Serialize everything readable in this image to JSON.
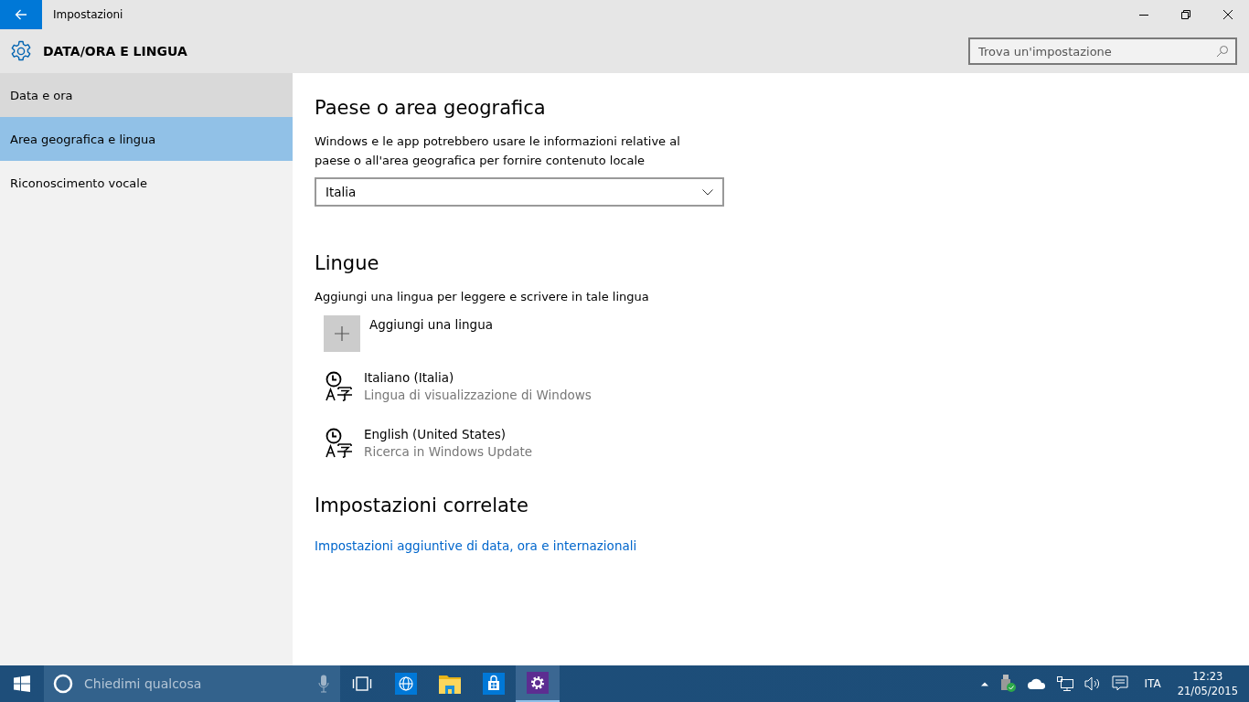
{
  "window": {
    "title": "Impostazioni"
  },
  "header": {
    "title": "DATA/ORA E LINGUA",
    "search": {
      "placeholder": "Trova un'impostazione"
    }
  },
  "sidebar": {
    "items": [
      {
        "label": "Data e ora",
        "selected": false,
        "hovered": true
      },
      {
        "label": "Area geografica e lingua",
        "selected": true,
        "hovered": false
      },
      {
        "label": "Riconoscimento vocale",
        "selected": false,
        "hovered": false
      }
    ]
  },
  "region": {
    "heading": "Paese o area geografica",
    "description": "Windows e le app potrebbero usare le informazioni relative al paese o all'area geografica per fornire contenuto locale",
    "country": "Italia"
  },
  "languages": {
    "heading": "Lingue",
    "description": "Aggiungi una lingua per leggere e scrivere in tale lingua",
    "add_label": "Aggiungi una lingua",
    "items": [
      {
        "name": "Italiano (Italia)",
        "status": "Lingua di visualizzazione di Windows"
      },
      {
        "name": "English (United States)",
        "status": "Ricerca in Windows Update"
      }
    ]
  },
  "related": {
    "heading": "Impostazioni correlate",
    "link": "Impostazioni aggiuntive di data, ora e internazionali"
  },
  "taskbar": {
    "search": {
      "placeholder": "Chiedimi qualcosa"
    },
    "apps": [
      {
        "kind": "browser",
        "active": false
      },
      {
        "kind": "explorer",
        "active": false
      },
      {
        "kind": "store",
        "active": false
      },
      {
        "kind": "settings",
        "active": true
      }
    ],
    "input_language": "ITA",
    "time": "12:23",
    "date": "21/05/2015"
  }
}
